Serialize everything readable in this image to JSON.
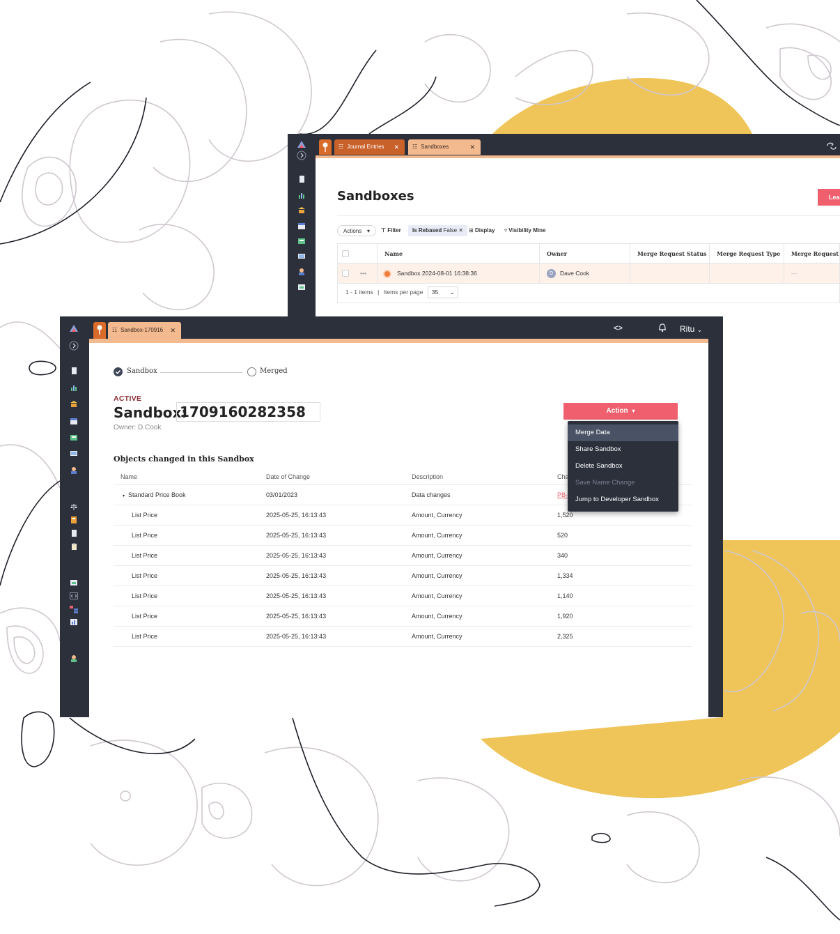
{
  "colors": {
    "sidebar_bg": "#2b303b",
    "accent_orange": "#c8612a",
    "tab_active": "#f3b98f",
    "action_red": "#ef5f6e",
    "highlight_yellow": "#efc458",
    "contour_grey": "#cfc8cf",
    "contour_dark": "#1e1e28"
  },
  "back_window": {
    "tabs": [
      {
        "label": "Journal Entries",
        "icon": "list-icon"
      },
      {
        "label": "Sandboxes",
        "icon": "list-icon"
      }
    ],
    "title": "Sandboxes",
    "leave_label": "Lea",
    "toolbar": {
      "actions": "Actions",
      "filter": "Filter",
      "rebased_key": "Is Rebased",
      "rebased_value": "False",
      "display": "Display",
      "visibility_key": "Visibility",
      "visibility_value": "Mine"
    },
    "columns": [
      "Name",
      "Owner",
      "Merge Request Status",
      "Merge Request Type",
      "Merge Request"
    ],
    "rows": [
      {
        "menu": "•••",
        "name": "Sandbox 2024-08-01 16:38:36",
        "owner_initial": "D",
        "owner": "Dave Cook",
        "merge_request": "—"
      }
    ],
    "pager": {
      "range": "1 - 1 items",
      "sep": "|",
      "per_page_label": "Items per page",
      "per_page": "35"
    }
  },
  "front_window": {
    "tab_label": "Sandbox-170916",
    "user": "Ritu",
    "stepper": {
      "step1": "Sandbox",
      "step2": "Merged"
    },
    "status": "ACTIVE",
    "title_prefix": "Sandbox:",
    "sandbox_id": "1709160282358",
    "owner": "Owner: D.Cook",
    "action_button": "Action",
    "action_menu": [
      {
        "label": "Merge Data",
        "state": "highlighted"
      },
      {
        "label": "Share Sandbox",
        "state": "enabled"
      },
      {
        "label": "Delete Sandbox",
        "state": "enabled"
      },
      {
        "label": "Save Name Change",
        "state": "disabled"
      },
      {
        "label": "Jump to Developer Sandbox",
        "state": "enabled"
      }
    ],
    "objects_title": "Objects changed in this Sandbox",
    "table": {
      "columns": [
        "Name",
        "Date of Change",
        "Description",
        "Cha"
      ],
      "parent_row": {
        "name": "Standard Price Book",
        "date": "03/01/2023",
        "description": "Data changes",
        "change": "PB-"
      },
      "rows": [
        {
          "name": "List Price",
          "date": "2025-05-25, 16:13:43",
          "description": "Amount, Currency",
          "change": "1,520"
        },
        {
          "name": "List Price",
          "date": "2025-05-25, 16:13:43",
          "description": "Amount, Currency",
          "change": "520"
        },
        {
          "name": "List Price",
          "date": "2025-05-25, 16:13:43",
          "description": "Amount, Currency",
          "change": "340"
        },
        {
          "name": "List Price",
          "date": "2025-05-25, 16:13:43",
          "description": "Amount, Currency",
          "change": "1,334"
        },
        {
          "name": "List Price",
          "date": "2025-05-25, 16:13:43",
          "description": "Amount, Currency",
          "change": "1,140"
        },
        {
          "name": "List Price",
          "date": "2025-05-25, 16:13:43",
          "description": "Amount, Currency",
          "change": "1,920"
        },
        {
          "name": "List Price",
          "date": "2025-05-25, 16:13:43",
          "description": "Amount, Currency",
          "change": "2,325"
        }
      ]
    }
  },
  "icons": {
    "logo": "mountain-logo-icon",
    "expand": "chevron-right-icon",
    "pin": "pin-icon",
    "code": "code-icon",
    "bell": "bell-icon",
    "caret": "chevron-down-icon",
    "sidebar": [
      "document-icon",
      "chart-icon",
      "bank-icon",
      "calendar-icon",
      "ledger-icon",
      "monitor-icon",
      "user-icon",
      "scale-icon",
      "book-icon",
      "page-icon",
      "clipboard-icon",
      "report-icon",
      "code-window-icon",
      "hierarchy-icon",
      "stats-icon",
      "admin-icon"
    ]
  }
}
